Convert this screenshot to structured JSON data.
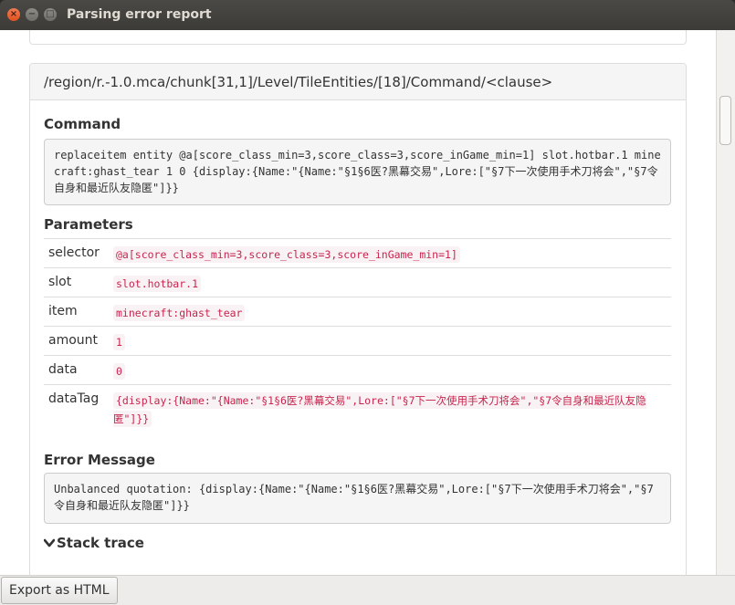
{
  "window": {
    "title": "Parsing error report"
  },
  "panel": {
    "heading": "/region/r.-1.0.mca/chunk[31,1]/Level/TileEntities/[18]/Command/<clause>"
  },
  "command": {
    "label": "Command",
    "text": "replaceitem entity @a[score_class_min=3,score_class=3,score_inGame_min=1] slot.hotbar.1 minecraft:ghast_tear 1 0 {display:{Name:\"{Name:\"§1§6医?黑幕交易\",Lore:[\"§7下一次使用手术刀将会\",\"§7令自身和最近队友隐匿\"]}}"
  },
  "parameters": {
    "label": "Parameters",
    "rows": [
      {
        "key": "selector",
        "value": "@a[score_class_min=3,score_class=3,score_inGame_min=1]"
      },
      {
        "key": "slot",
        "value": "slot.hotbar.1"
      },
      {
        "key": "item",
        "value": "minecraft:ghast_tear"
      },
      {
        "key": "amount",
        "value": "1"
      },
      {
        "key": "data",
        "value": "0"
      },
      {
        "key": "dataTag",
        "value": "{display:{Name:\"{Name:\"§1§6医?黑幕交易\",Lore:[\"§7下一次使用手术刀将会\",\"§7令自身和最近队友隐匿\"]}}"
      }
    ]
  },
  "error": {
    "label": "Error Message",
    "text": "Unbalanced quotation: {display:{Name:\"{Name:\"§1§6医?黑幕交易\",Lore:[\"§7下一次使用手术刀将会\",\"§7令自身和最近队友隐匿\"]}}"
  },
  "stack": {
    "label": "Stack trace",
    "icon": "chevron-down-icon"
  },
  "footer": {
    "export_label": "Export as HTML"
  },
  "colors": {
    "accent_close": "#e0531f",
    "code_text": "#c7254e",
    "code_bg": "#f9f2f4"
  }
}
